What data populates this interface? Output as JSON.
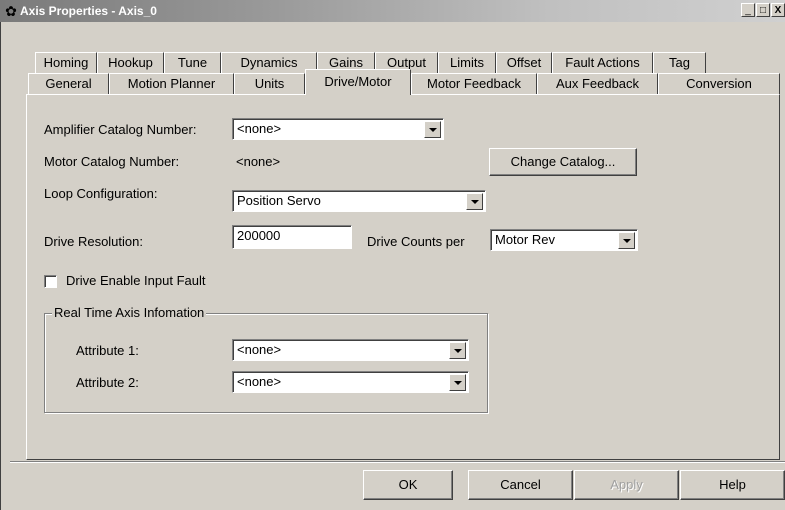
{
  "window": {
    "title": "Axis Properties - Axis_0",
    "icon": "gear-icon",
    "minimize": "_",
    "maximize": "□",
    "close": "X"
  },
  "tabs_back": [
    "Homing",
    "Hookup",
    "Tune",
    "Dynamics",
    "Gains",
    "Output",
    "Limits",
    "Offset",
    "Fault Actions",
    "Tag"
  ],
  "tabs_front": [
    "General",
    "Motion Planner",
    "Units",
    "Drive/Motor",
    "Motor Feedback",
    "Aux Feedback",
    "Conversion"
  ],
  "active_tab": "Drive/Motor",
  "form": {
    "amp_catalog_label": "Amplifier Catalog Number:",
    "amp_catalog_value": "<none>",
    "motor_catalog_label": "Motor Catalog Number:",
    "motor_catalog_value": "<none>",
    "change_catalog": "Change Catalog...",
    "loop_config_label": "Loop Configuration:",
    "loop_config_value": "Position Servo",
    "drive_resolution_label": "Drive Resolution:",
    "drive_resolution_value": "200000",
    "drive_counts_label": "Drive Counts per",
    "drive_counts_value": "Motor Rev",
    "drive_enable_fault_label": "Drive Enable Input Fault",
    "drive_enable_fault_checked": false,
    "realtime_group_title": "Real Time Axis Infomation",
    "attr1_label": "Attribute 1:",
    "attr1_value": "<none>",
    "attr2_label": "Attribute 2:",
    "attr2_value": "<none>"
  },
  "buttons": {
    "ok": "OK",
    "cancel": "Cancel",
    "apply": "Apply",
    "help": "Help"
  }
}
